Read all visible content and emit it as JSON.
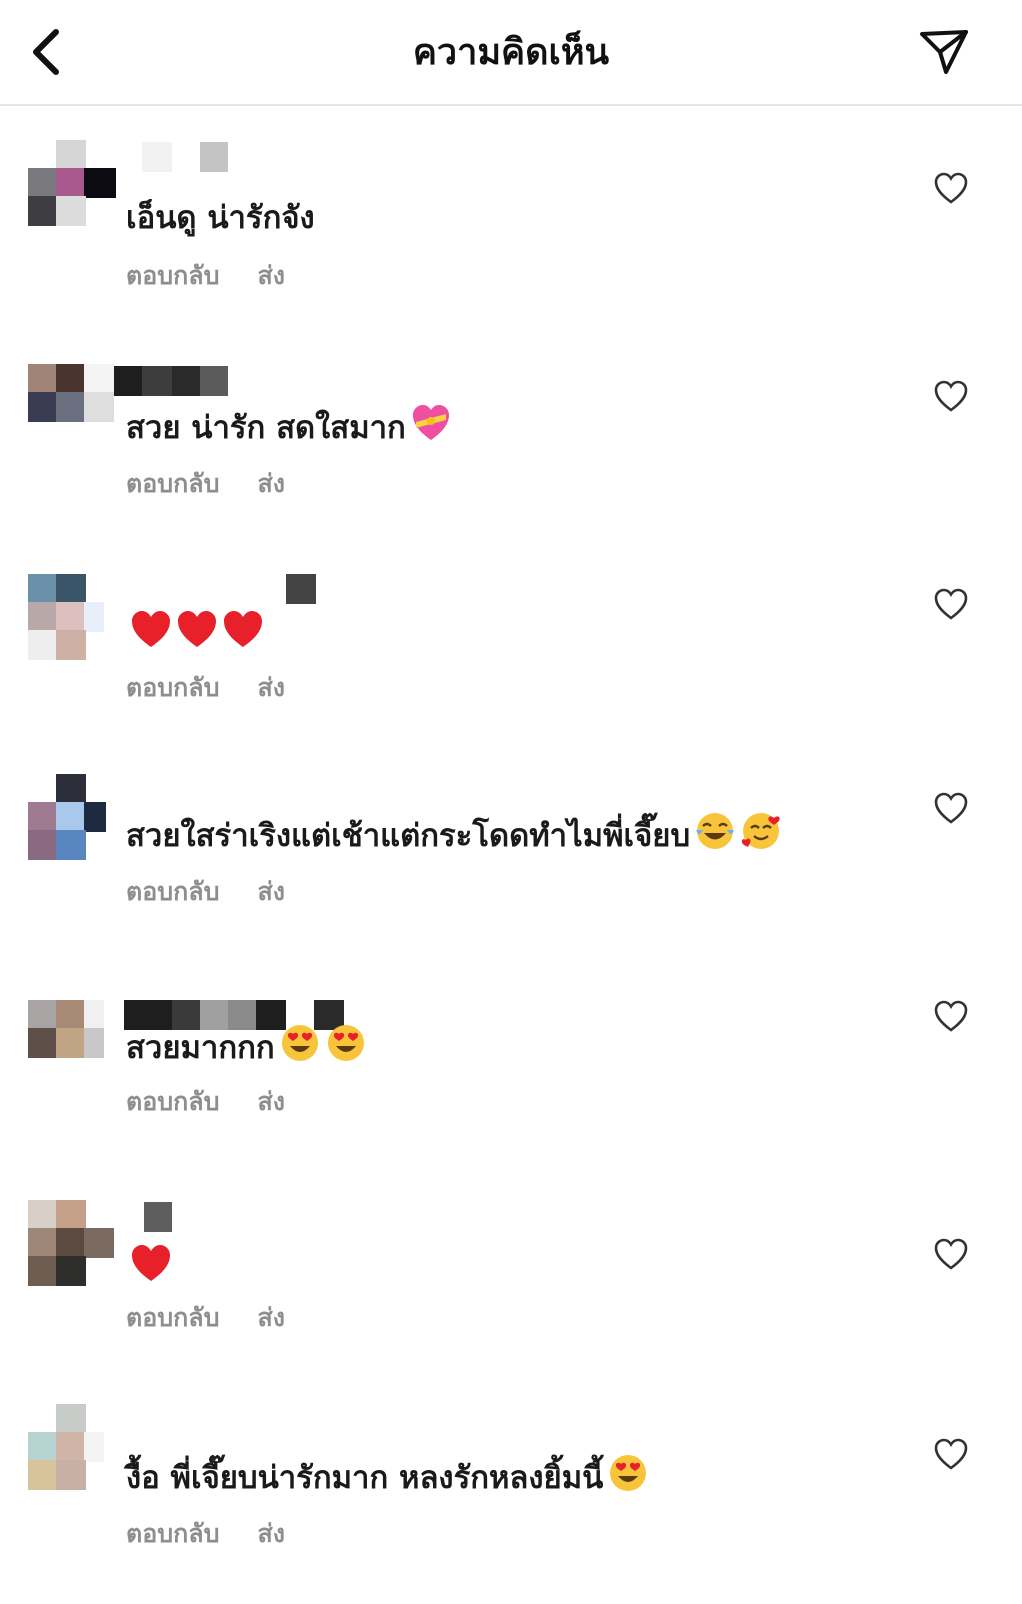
{
  "header": {
    "title": "ความคิดเห็น"
  },
  "reply_label": "ตอบกลับ",
  "send_label": "ส่ง",
  "comments": [
    {
      "text": "เอ็นดู น่ารักจัง",
      "emojis": []
    },
    {
      "text": "สวย น่ารัก สดใสมาก",
      "emojis": [
        "heart-with-ribbon"
      ]
    },
    {
      "text": "",
      "emojis": [
        "red-heart",
        "red-heart",
        "red-heart"
      ]
    },
    {
      "text": "สวยใสร่าเริงแต่เช้าแต่กระโดดทำไมพี่เจี๊ยบ",
      "emojis": [
        "face-with-tears-of-joy",
        "smiling-face-with-hearts"
      ]
    },
    {
      "text": "สวยมากกก",
      "emojis": [
        "heart-eyes",
        "heart-eyes"
      ]
    },
    {
      "text": "",
      "emojis": [
        "red-heart"
      ]
    },
    {
      "text": "งื้อ พี่เจี๊ยบน่ารักมาก หลงรักหลงยิ้มนี้",
      "emojis": [
        "heart-eyes"
      ]
    }
  ],
  "colors": {
    "text": "#1a1a1a",
    "muted": "#8e8e8e",
    "divider": "#e6e6e6",
    "heart": "#e8202a"
  }
}
